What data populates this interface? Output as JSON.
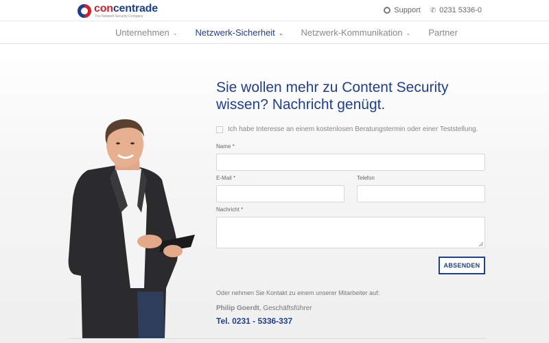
{
  "brand": {
    "logo_con": "con",
    "logo_centrade": "centrade",
    "tagline": "The Network Security Company"
  },
  "topbar": {
    "support_label": "Support",
    "phone_label": "0231 5336-0"
  },
  "nav": {
    "items": [
      {
        "label": "Unternehmen",
        "has_dropdown": true,
        "active": false
      },
      {
        "label": "Netzwerk-Sicherheit",
        "has_dropdown": true,
        "active": true
      },
      {
        "label": "Netzwerk-Kommunikation",
        "has_dropdown": true,
        "active": false
      },
      {
        "label": "Partner",
        "has_dropdown": false,
        "active": false
      }
    ]
  },
  "form": {
    "heading": "Sie wollen mehr zu Content Security wissen? Nachricht genügt.",
    "checkbox_label": "Ich habe Interesse an einem kostenlosen Beratungstermin oder einer Teststellung.",
    "checkbox_checked": false,
    "name_label": "Name *",
    "name_value": "",
    "email_label": "E-Mail *",
    "email_value": "",
    "phone_label": "Telefon",
    "phone_value": "",
    "message_label": "Nachricht *",
    "message_value": "",
    "submit_label": "ABSENDEN"
  },
  "contact": {
    "intro": "Oder nehmen Sie Kontakt zu einem unserer Mitarbeiter auf:",
    "name": "Philip Goerdt",
    "role": ", Geschäftsführer",
    "phone": "Tel. 0231 - 5336-337"
  },
  "colors": {
    "brand_blue": "#1d3f8f",
    "brand_red": "#d2202a",
    "nav_inactive": "#888888"
  }
}
